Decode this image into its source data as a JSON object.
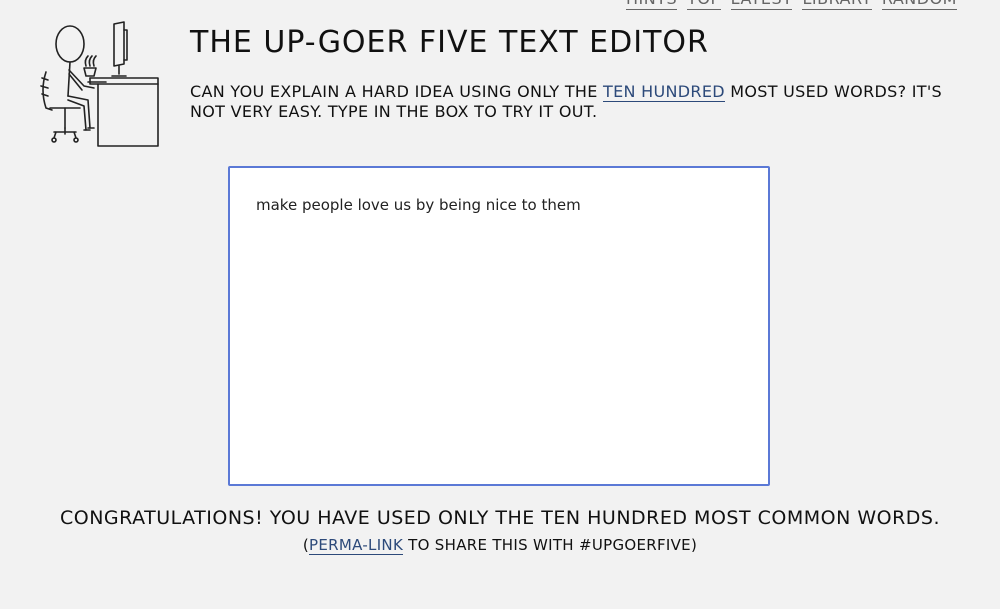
{
  "nav": {
    "items": [
      {
        "label": "HINTS"
      },
      {
        "label": "TOP"
      },
      {
        "label": "LATEST"
      },
      {
        "label": "LIBRARY"
      },
      {
        "label": "RANDOM"
      }
    ]
  },
  "header": {
    "title": "THE UP-GOER FIVE TEXT EDITOR",
    "intro_before": "CAN YOU EXPLAIN A HARD IDEA USING ONLY THE ",
    "intro_link": "TEN HUNDRED",
    "intro_after": " MOST USED WORDS? IT'S NOT VERY EASY. TYPE IN THE BOX TO TRY IT OUT.",
    "illustration_icon": "person-at-desk-icon"
  },
  "editor": {
    "value": "make people love us by being nice to them",
    "border_color": "#5b79d6"
  },
  "result": {
    "message": "CONGRATULATIONS! YOU HAVE USED ONLY THE TEN HUNDRED MOST COMMON WORDS.",
    "share_open": "(",
    "share_link": "PERMA-LINK",
    "share_after": " TO SHARE THIS WITH #UPGOERFIVE)"
  },
  "colors": {
    "background": "#f2f2f2",
    "link": "#2d4a7a"
  }
}
